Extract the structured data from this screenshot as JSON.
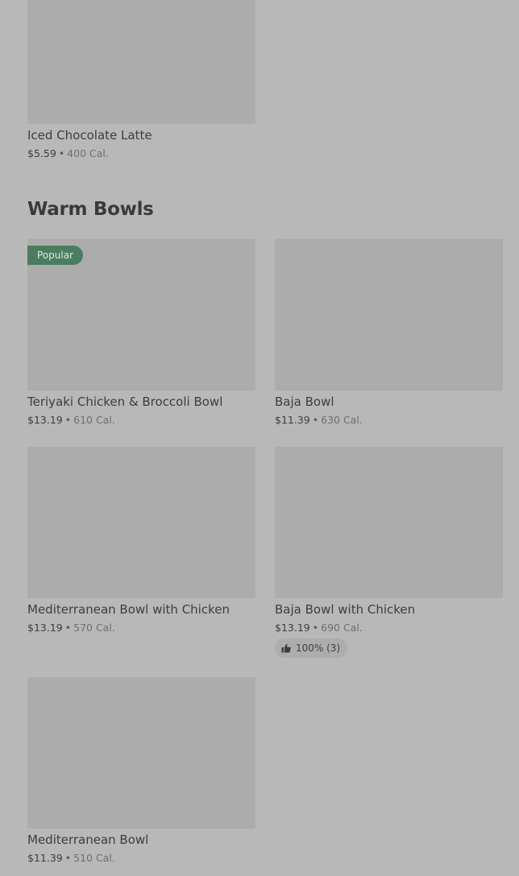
{
  "items": {
    "iced_chocolate_latte": {
      "name": "Iced Chocolate Latte",
      "price": "$5.59",
      "sep": "•",
      "cal": "400 Cal."
    }
  },
  "section": {
    "title": "Warm Bowls"
  },
  "bowls": {
    "teriyaki": {
      "badge": "Popular",
      "name": "Teriyaki Chicken & Broccoli Bowl",
      "price": "$13.19",
      "sep": "•",
      "cal": "610 Cal."
    },
    "baja": {
      "name": "Baja Bowl",
      "price": "$11.39",
      "sep": "•",
      "cal": "630 Cal."
    },
    "med_chicken": {
      "name": "Mediterranean Bowl with Chicken",
      "price": "$13.19",
      "sep": "•",
      "cal": "570 Cal."
    },
    "baja_chicken": {
      "name": "Baja Bowl with Chicken",
      "price": "$13.19",
      "sep": "•",
      "cal": "690 Cal.",
      "rating": "100% (3)"
    },
    "med": {
      "name": "Mediterranean Bowl",
      "price": "$11.39",
      "sep": "•",
      "cal": "510 Cal."
    }
  },
  "colors": {
    "badge": "#4a7d5e",
    "background": "#b8b8b8",
    "image_placeholder": "#acacac"
  },
  "icons": {
    "rating": "thumbs-up-icon"
  }
}
